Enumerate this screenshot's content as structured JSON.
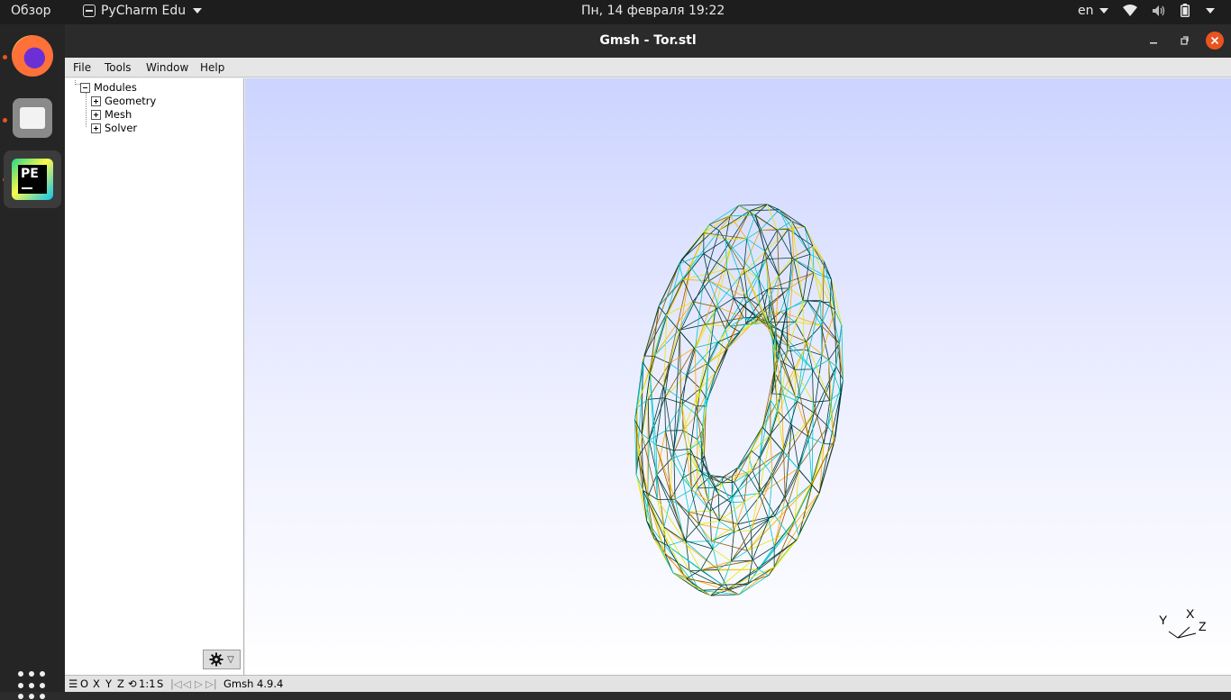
{
  "topbar": {
    "activities": "Обзор",
    "app_name": "PyCharm Edu",
    "clock": "Пн, 14 февраля  19:22",
    "language": "en"
  },
  "dock": {
    "items": [
      "firefox-icon",
      "files-icon",
      "pycharm-icon"
    ],
    "pycharm_icon_text": "PE",
    "show_apps": "grid-icon"
  },
  "window": {
    "title": "Gmsh - Tor.stl"
  },
  "menu": {
    "file": "File",
    "tools": "Tools",
    "window": "Window",
    "help": "Help"
  },
  "tree": {
    "root": "Modules",
    "children": [
      "Geometry",
      "Mesh",
      "Solver"
    ]
  },
  "viewport": {
    "axes": {
      "x": "X",
      "y": "Y",
      "z": "Z"
    },
    "background_top": "#ccd4ff",
    "background_bottom": "#ffffff",
    "mesh_colors": [
      "#003a3a",
      "#00c8c8",
      "#ffa500",
      "#8b5a00",
      "#e6e600"
    ]
  },
  "statusbar": {
    "views": [
      "O",
      "X",
      "Y",
      "Z"
    ],
    "scale": "1:1",
    "s_label": "S",
    "version": "Gmsh 4.9.4"
  }
}
